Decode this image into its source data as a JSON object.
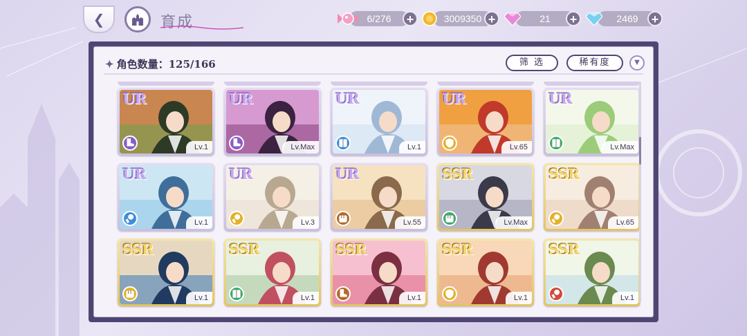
{
  "header": {
    "title": "育成"
  },
  "currencies": [
    {
      "name": "stamina",
      "icon": "candy-icon",
      "value": "6/276"
    },
    {
      "name": "gold",
      "icon": "gold-coin-icon",
      "value": "3009350"
    },
    {
      "name": "pink-gem",
      "icon": "pink-diamond-icon",
      "value": "21"
    },
    {
      "name": "blue-gem",
      "icon": "blue-diamond-icon",
      "value": "2469"
    }
  ],
  "panel": {
    "count_label": "角色数量：",
    "count_value": "125/166",
    "filter_label": "筛 选",
    "rarity_label": "稀有度"
  },
  "colors": {
    "ur_frame": "#c9bfe0",
    "ssr_frame": "#e2c462",
    "panel_border": "#4e4672",
    "attr_purple": "#8a5cc7",
    "attr_blue": "#3f8ed8",
    "attr_yellow": "#e3b12c",
    "attr_green": "#3fa86a",
    "attr_brown": "#b36a2a",
    "attr_red": "#d24a3a"
  },
  "cards": [
    {
      "rarity": "UR",
      "level": "Lv.1",
      "attr": "purple",
      "attr_icon": "boot-icon"
    },
    {
      "rarity": "UR",
      "level": "Lv.Max",
      "attr": "purple",
      "attr_icon": "boot-icon"
    },
    {
      "rarity": "UR",
      "level": "Lv.1",
      "attr": "blue",
      "attr_icon": "book-icon"
    },
    {
      "rarity": "UR",
      "level": "Lv.65",
      "attr": "yellow",
      "attr_icon": "shield-icon"
    },
    {
      "rarity": "UR",
      "level": "Lv.Max",
      "attr": "green",
      "attr_icon": "book-icon"
    },
    {
      "rarity": "UR",
      "level": "Lv.1",
      "attr": "blue",
      "attr_icon": "brush-icon"
    },
    {
      "rarity": "UR",
      "level": "Lv.3",
      "attr": "yellow",
      "attr_icon": "brush-icon"
    },
    {
      "rarity": "UR",
      "level": "Lv.55",
      "attr": "brown",
      "attr_icon": "fist-icon"
    },
    {
      "rarity": "SSR",
      "level": "Lv.Max",
      "attr": "green",
      "attr_icon": "fist-icon"
    },
    {
      "rarity": "SSR",
      "level": "Lv.65",
      "attr": "yellow",
      "attr_icon": "brush-icon"
    },
    {
      "rarity": "SSR",
      "level": "Lv.1",
      "attr": "yellow",
      "attr_icon": "fist-icon"
    },
    {
      "rarity": "SSR",
      "level": "Lv.1",
      "attr": "green",
      "attr_icon": "book-icon"
    },
    {
      "rarity": "SSR",
      "level": "Lv.1",
      "attr": "brown",
      "attr_icon": "boot-icon"
    },
    {
      "rarity": "SSR",
      "level": "Lv.1",
      "attr": "yellow",
      "attr_icon": "shield-icon"
    },
    {
      "rarity": "SSR",
      "level": "Lv.1",
      "attr": "red",
      "attr_icon": "brush-icon"
    }
  ]
}
